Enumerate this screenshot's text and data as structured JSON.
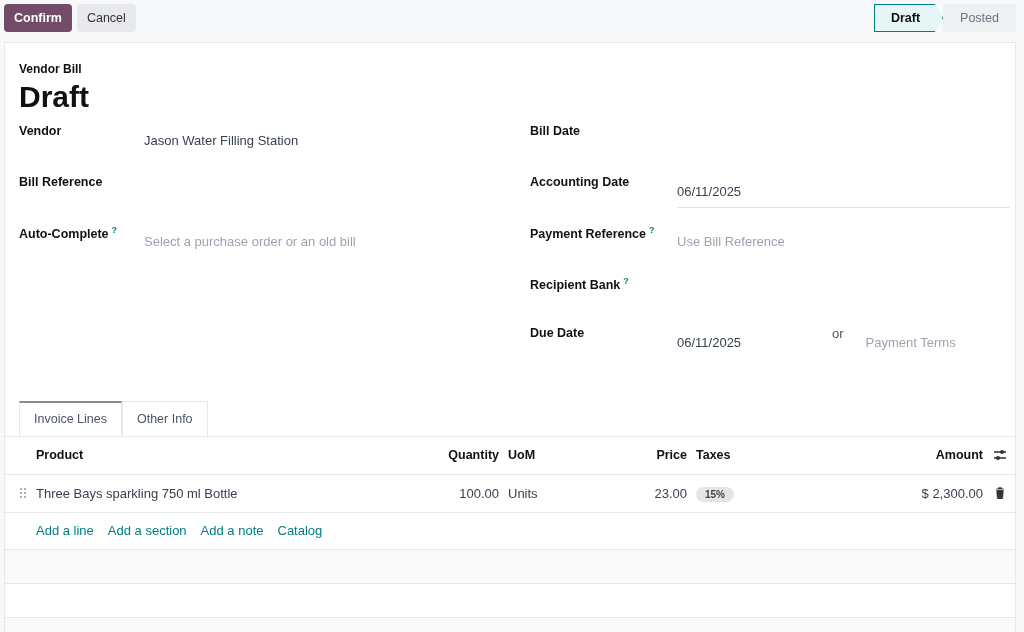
{
  "actions": [
    {
      "label": "Confirm",
      "kind": "primary"
    },
    {
      "label": "Cancel",
      "kind": "secondary"
    }
  ],
  "status_steps": [
    {
      "label": "Draft",
      "selected": true
    },
    {
      "label": "Posted",
      "selected": false
    }
  ],
  "doc_type": "Vendor Bill",
  "title": "Draft",
  "left_fields": [
    {
      "label": "Vendor",
      "value": "Jason Water Filling Station"
    },
    {
      "label": "Bill Reference"
    },
    {
      "label": "Auto-Complete",
      "help": "?",
      "placeholder": "Select a purchase order or an old bill"
    }
  ],
  "right_fields": [
    {
      "label": "Bill Date"
    },
    {
      "label": "Accounting Date",
      "value": "06/11/2025",
      "focused": true
    },
    {
      "label": "Payment Reference",
      "help": "?",
      "placeholder": "Use Bill Reference"
    },
    {
      "label": "Recipient Bank",
      "help": "?"
    },
    {
      "label": "Due Date",
      "value": "06/11/2025",
      "separator": "or",
      "placeholder2": "Payment Terms"
    }
  ],
  "tabs": [
    {
      "label": "Invoice Lines",
      "selected": true
    },
    {
      "label": "Other Info",
      "selected": false
    }
  ],
  "table": {
    "columns": [
      "Product",
      "Quantity",
      "UoM",
      "Price",
      "Taxes",
      "Amount"
    ],
    "rows": [
      {
        "product": "Three Bays sparkling 750 ml Bottle",
        "quantity": "100.00",
        "uom": "Units",
        "price": "23.00",
        "taxes": "15%",
        "amount": "$ 2,300.00"
      }
    ],
    "add_links": [
      "Add a line",
      "Add a section",
      "Add a note",
      "Catalog"
    ]
  }
}
